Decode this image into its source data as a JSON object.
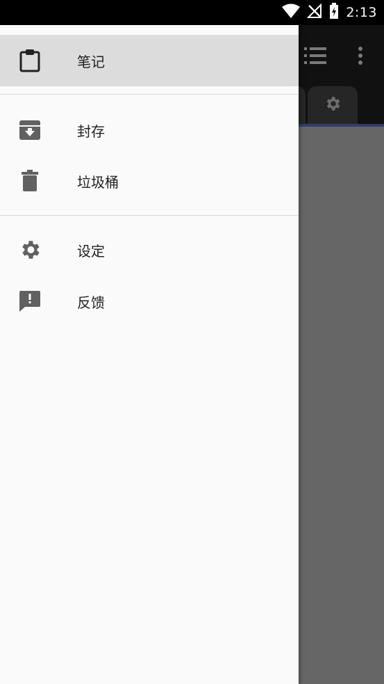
{
  "status_bar": {
    "time": "2:13",
    "icons": [
      "wifi-icon",
      "no-signal-icon",
      "battery-charging-icon"
    ]
  },
  "drawer": {
    "primary_items": [
      {
        "label": "笔记",
        "icon": "clipboard-icon",
        "selected": true
      }
    ],
    "secondary_items": [
      {
        "label": "封存",
        "icon": "archive-icon"
      },
      {
        "label": "垃圾桶",
        "icon": "trash-icon"
      }
    ],
    "tertiary_items": [
      {
        "label": "设定",
        "icon": "gear-icon"
      },
      {
        "label": "反馈",
        "icon": "feedback-icon"
      }
    ]
  },
  "background_app": {
    "toolbar_icons": [
      "list-view-icon",
      "more-vert-icon"
    ],
    "tab_icons": [
      "gear-icon"
    ]
  },
  "colors": {
    "drawer_bg": "#fafafa",
    "selected_item_bg": "#dcdcdc",
    "icon_color": "#616161",
    "scrim": "#666666",
    "accent_line": "#2d3e6e"
  }
}
